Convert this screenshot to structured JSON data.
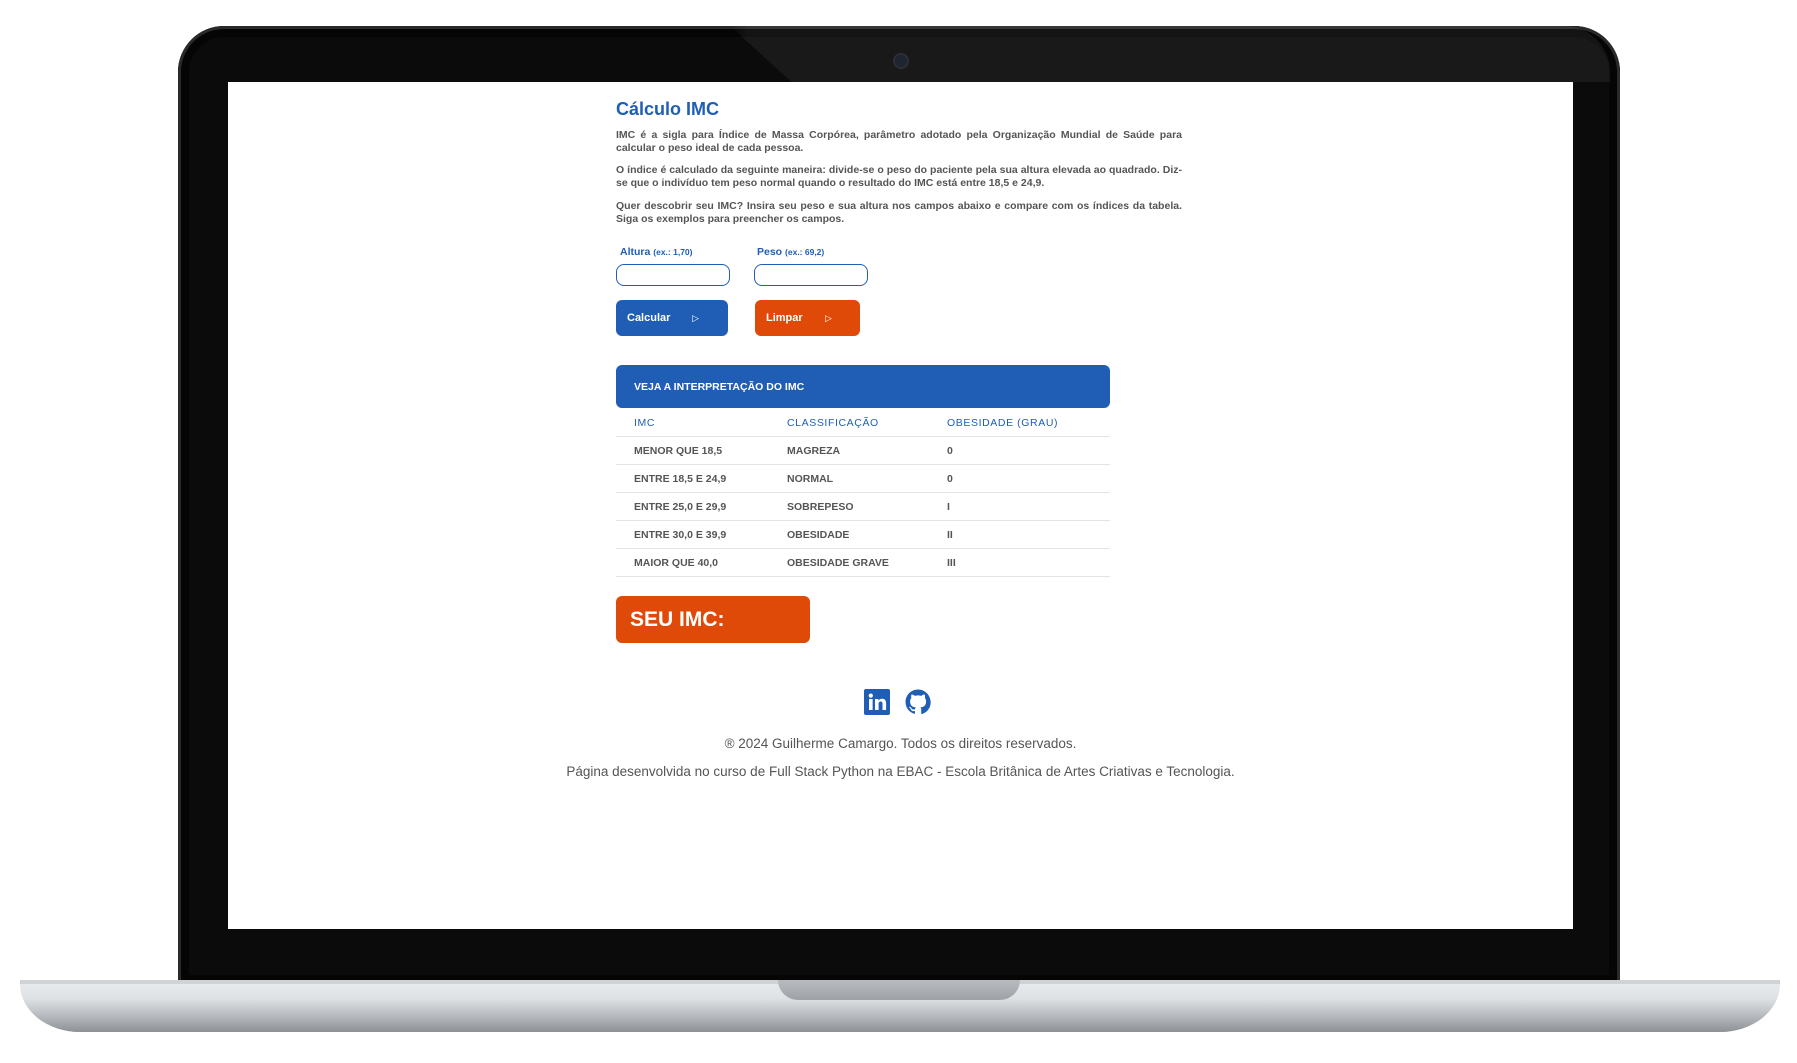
{
  "page": {
    "title": "Cálculo IMC",
    "paragraphs": [
      "IMC é a sigla para Índice de Massa Corpórea, parâmetro adotado pela Organização Mundial de Saúde para calcular o peso ideal de cada pessoa.",
      "O índice é calculado da seguinte maneira: divide-se o peso do paciente pela sua altura elevada ao quadrado. Diz-se que o indivíduo tem peso normal quando o resultado do IMC está entre 18,5 e 24,9.",
      "Quer descobrir seu IMC? Insira seu peso e sua altura nos campos abaixo e compare com os índices da tabela. Siga os exemplos para preencher os campos."
    ]
  },
  "form": {
    "altura_label": "Altura",
    "altura_hint": "(ex.: 1,70)",
    "altura_value": "",
    "peso_label": "Peso",
    "peso_hint": "(ex.: 69,2)",
    "peso_value": "",
    "calcular_label": "Calcular",
    "limpar_label": "Limpar"
  },
  "table": {
    "title": "VEJA A INTERPRETAÇÃO DO IMC",
    "columns": [
      "IMC",
      "CLASSIFICAÇÃO",
      "OBESIDADE (GRAU)"
    ],
    "rows": [
      [
        "MENOR QUE 18,5",
        "MAGREZA",
        "0"
      ],
      [
        "ENTRE 18,5 E 24,9",
        "NORMAL",
        "0"
      ],
      [
        "ENTRE 25,0 E 29,9",
        "SOBREPESO",
        "I"
      ],
      [
        "ENTRE 30,0 E 39,9",
        "OBESIDADE",
        "II"
      ],
      [
        "MAIOR QUE 40,0",
        "OBESIDADE GRAVE",
        "III"
      ]
    ]
  },
  "result": {
    "label": "SEU IMC:"
  },
  "footer": {
    "icons": [
      "linkedin-icon",
      "github-icon"
    ],
    "copyright": "® 2024 Guilherme Camargo. Todos os direitos reservados.",
    "credit": "Página desenvolvida no curso de Full Stack Python na EBAC - Escola Britânica de Artes Criativas e Tecnologia."
  },
  "colors": {
    "primary": "#1f5eb4",
    "accent": "#df4a08",
    "text": "#555555"
  }
}
